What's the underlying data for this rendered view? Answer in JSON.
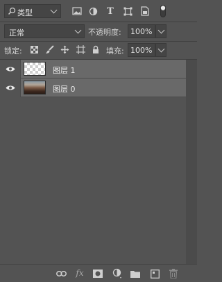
{
  "filter": {
    "kind_label": "类型",
    "icons": [
      "image-filter-icon",
      "adjustment-filter-icon",
      "type-filter-icon",
      "shape-filter-icon",
      "smart-object-filter-icon",
      "filter-toggle-icon"
    ]
  },
  "blend": {
    "mode": "正常",
    "opacity_label": "不透明度:",
    "opacity_value": "100%"
  },
  "lock": {
    "label": "锁定:",
    "icons": [
      "lock-transparent-pixels-icon",
      "lock-image-pixels-icon",
      "lock-position-icon",
      "lock-artboard-icon",
      "lock-all-icon"
    ],
    "fill_label": "填充:",
    "fill_value": "100%"
  },
  "layers": [
    {
      "name": "图层 1",
      "visible": true,
      "thumbnail": "transparent"
    },
    {
      "name": "图层 0",
      "visible": true,
      "thumbnail": "photo"
    }
  ],
  "bottom_icons": [
    "link-layers-icon",
    "fx-icon",
    "add-mask-icon",
    "new-adjustment-layer-icon",
    "new-group-icon",
    "new-layer-icon",
    "delete-layer-icon"
  ],
  "bottom_fx_text": "fx",
  "type_icon_glyph": "T",
  "colors": {
    "panel_bg": "#535353",
    "row_bg": "#696969",
    "field_bg": "#454545"
  }
}
